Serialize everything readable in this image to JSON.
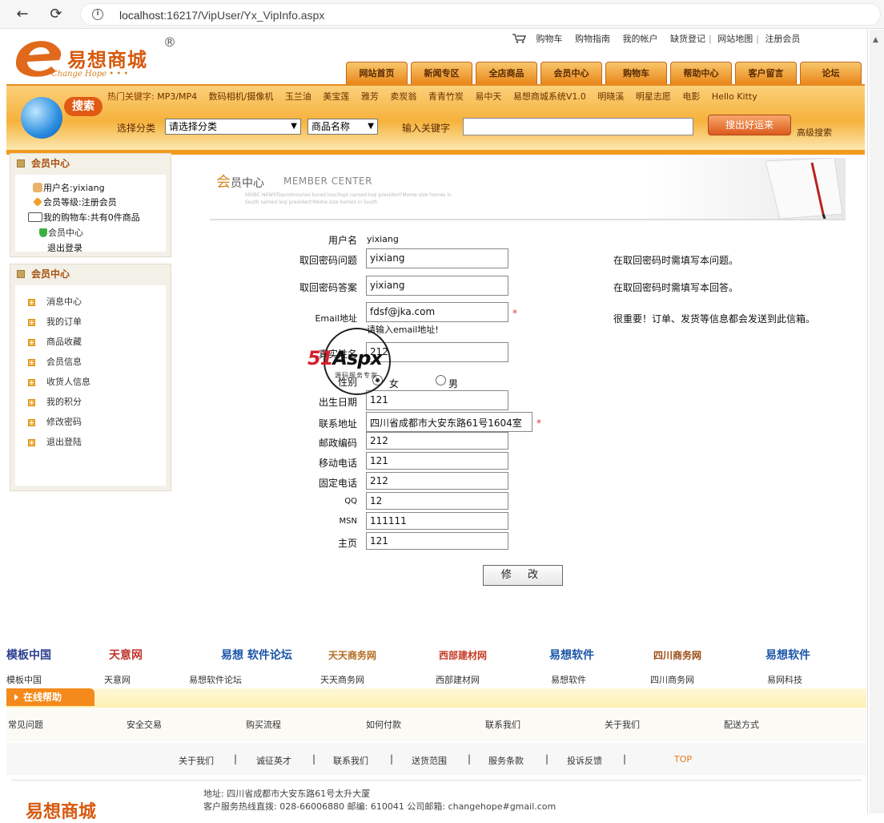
{
  "browser": {
    "url_host": "localhost",
    "url_rest": ":16217/VipUser/Yx_VipInfo.aspx"
  },
  "header": {
    "logo_text": "易想商城",
    "logo_sub": "Change Hope",
    "logo_reg": "®",
    "toplinks": [
      "购物车",
      "购物指南",
      "我的帐户",
      "缺货登记",
      "网站地图",
      "注册会员"
    ],
    "nav": [
      "网站首页",
      "新闻专区",
      "全店商品",
      "会员中心",
      "购物车",
      "帮助中心",
      "客户留言",
      "论坛"
    ]
  },
  "search": {
    "badge": "搜索",
    "hot_label": "热门关键字:",
    "hot_keywords": [
      "MP3/MP4",
      "数码相机/摄像机",
      "玉兰油",
      "美宝莲",
      "雅芳",
      "卖炭翁",
      "青青竹炭",
      "易中天",
      "易想商城系统V1.0",
      "明晓溪",
      "明星志愿",
      "电影",
      "Hello Kitty"
    ],
    "category_label": "选择分类",
    "category_value": "请选择分类",
    "field_value": "商品名称",
    "keyword_label": "输入关键字",
    "button": "搜出好运来",
    "advanced": "高级搜索"
  },
  "sidebar": {
    "box1_title": "会员中心",
    "username_label": "用户名:",
    "username": "yixiang",
    "level_label": "会员等级:",
    "level": "注册会员",
    "cart_label": "我的购物车:",
    "cart_value": "共有0件商品",
    "member_center_link": "会员中心",
    "logout_link": "退出登录",
    "box2_title": "会员中心",
    "menu": [
      "消息中心",
      "我的订单",
      "商品收藏",
      "会员信息",
      "收货人信息",
      "我的积分",
      "修改密码",
      "退出登陆"
    ]
  },
  "banner": {
    "title_main": "会",
    "title_rest": "员中心",
    "en": "MEMBER CENTER",
    "tiny": "MSIBC NEWSTopcolmounes tuned loocitupt named loqi president'Mome size homes in South named loqi president'Mome size homes in South"
  },
  "form": {
    "fields": [
      {
        "label": "用户名",
        "value": "yixiang"
      },
      {
        "label": "取回密码问题",
        "value": "yixiang",
        "note": "在取回密码时需填写本问题。"
      },
      {
        "label": "取回密码答案",
        "value": "yixiang",
        "note": "在取回密码时需填写本回答。"
      },
      {
        "label": "Email地址",
        "value": "fdsf@jka.com",
        "note": "很重要！订单、发货等信息都会发送到此信箱。",
        "hint": "请输入email地址!",
        "required": "*"
      },
      {
        "label": "真实姓名",
        "value": "212"
      },
      {
        "label": "性别",
        "female": "女",
        "male": "男"
      },
      {
        "label": "出生日期",
        "value": "121"
      },
      {
        "label": "联系地址",
        "value": "四川省成都市大安东路61号1604室",
        "required": "*"
      },
      {
        "label": "邮政编码",
        "value": "212"
      },
      {
        "label": "移动电话",
        "value": "121"
      },
      {
        "label": "固定电话",
        "value": "212"
      },
      {
        "label": "QQ",
        "value": "12"
      },
      {
        "label": "MSN",
        "value": "111111"
      },
      {
        "label": "主页",
        "value": "121"
      }
    ],
    "submit": "修 改"
  },
  "watermark": {
    "brand_num": "51",
    "brand_text": "Aspx",
    "sub": "源码服务专家"
  },
  "partners": [
    {
      "logo": "模板中国",
      "caption": "模板中国"
    },
    {
      "logo": "天意网",
      "caption": "天意网"
    },
    {
      "logo": "易想 软件论坛",
      "caption": "易想软件论坛"
    },
    {
      "logo": "天天商务网",
      "caption": "天天商务网"
    },
    {
      "logo": "西部建材网",
      "caption": "西部建材网"
    },
    {
      "logo": "易想软件",
      "caption": "易想软件"
    },
    {
      "logo": "四川商务网",
      "caption": "四川商务网"
    },
    {
      "logo": "易想软件",
      "caption": "易网科技"
    }
  ],
  "help": {
    "title": "在线帮助",
    "links": [
      "常见问题",
      "安全交易",
      "购买流程",
      "如何付款",
      "联系我们",
      "关于我们",
      "配送方式"
    ]
  },
  "footer": {
    "links": [
      "关于我们",
      "诚征英才",
      "联系我们",
      "送货范围",
      "服务条款",
      "投诉反馈"
    ],
    "top": "TOP",
    "address": "地址: 四川省成都市大安东路61号太升大厦",
    "contact": "客户服务热线直拨: 028-66006880 邮编: 610041 公司邮箱: changehope#gmail.com",
    "logo": "易想商城"
  },
  "colors": {
    "brand_orange": "#d65a0f",
    "nav_tab": "#f0a23a",
    "accent": "#f38a1b",
    "required": "#e03333"
  }
}
